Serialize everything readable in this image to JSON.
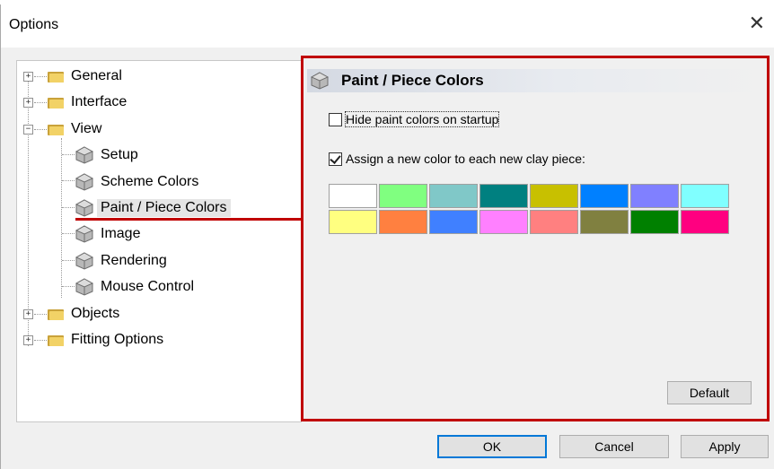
{
  "dialog": {
    "title": "Options",
    "close_glyph": "✕"
  },
  "tree": {
    "items": [
      {
        "label": "General",
        "icon": "folder-icon",
        "expander": "+"
      },
      {
        "label": "Interface",
        "icon": "folder-icon",
        "expander": "+"
      },
      {
        "label": "View",
        "icon": "folder-icon",
        "expander": "−"
      },
      {
        "label": "Setup",
        "icon": "piece-icon"
      },
      {
        "label": "Scheme Colors",
        "icon": "piece-icon"
      },
      {
        "label": "Paint / Piece Colors",
        "icon": "piece-icon",
        "selected": true
      },
      {
        "label": "Image",
        "icon": "piece-icon"
      },
      {
        "label": "Rendering",
        "icon": "piece-icon"
      },
      {
        "label": "Mouse Control",
        "icon": "piece-icon"
      },
      {
        "label": "Objects",
        "icon": "folder-icon",
        "expander": "+"
      },
      {
        "label": "Fitting Options",
        "icon": "folder-icon",
        "expander": "+"
      }
    ]
  },
  "panel": {
    "title": "Paint / Piece Colors",
    "hide_paint_label": "Hide paint colors on startup",
    "hide_paint_checked": false,
    "assign_color_label": "Assign a new color to each new clay piece:",
    "assign_color_checked": true,
    "swatches": [
      [
        "#ffffff",
        "#80ff80",
        "#80c8c8",
        "#008080",
        "#c8c000",
        "#0080ff",
        "#8080ff",
        "#80ffff"
      ],
      [
        "#ffff80",
        "#ff8040",
        "#4080ff",
        "#ff80ff",
        "#ff8080",
        "#808040",
        "#008000",
        "#ff0080"
      ]
    ],
    "default_button": "Default"
  },
  "footer": {
    "ok": "OK",
    "cancel": "Cancel",
    "apply": "Apply"
  },
  "colors": {
    "highlight": "#c00000",
    "ok_border": "#0078d7"
  }
}
